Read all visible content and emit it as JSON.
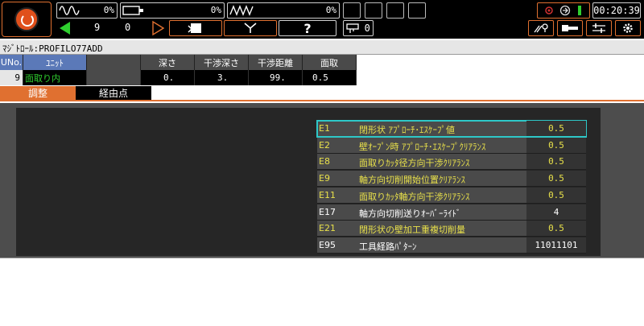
{
  "topbar": {
    "spindle_load_pct": "0%",
    "feed_load_pct": "0%",
    "axis_load_pct": "0%",
    "counter_left": "9",
    "counter_right": "0",
    "key_count": "0",
    "clock": "00:20:39",
    "help_label": "?"
  },
  "titlebar": {
    "program": "ﾏｼﾞﾄﾛｰﾙ:PROFILO77ADD"
  },
  "unit_table": {
    "headers": {
      "uno": "UNo.",
      "unit": "ﾕﾆｯﾄ",
      "depth": "深さ",
      "interference_depth": "干渉深さ",
      "interference_dist": "干渉距離",
      "chamfer": "面取"
    },
    "row": {
      "uno": "9",
      "unit": "面取り内",
      "depth": "0.",
      "interference_depth": "3.",
      "interference_dist": "99.",
      "chamfer": "0.5"
    }
  },
  "tabs": {
    "adjust": "調整",
    "waypoint": "経由点"
  },
  "params": [
    {
      "code": "E1",
      "name": "閉形状 ｱﾌﾟﾛｰﾁ･ｴｽｹｰﾌﾟ値",
      "value": "0.5",
      "color": "#e8e04a"
    },
    {
      "code": "E2",
      "name": "壁ｵｰﾌﾟﾝ時 ｱﾌﾟﾛｰﾁ･ｴｽｹｰﾌﾟｸﾘｱﾗﾝｽ",
      "value": "0.5",
      "color": "#e8e04a"
    },
    {
      "code": "E8",
      "name": "面取りｶｯﾀ径方向干渉ｸﾘｱﾗﾝｽ",
      "value": "0.5",
      "color": "#e8e04a"
    },
    {
      "code": "E9",
      "name": "軸方向切削開始位置ｸﾘｱﾗﾝｽ",
      "value": "0.5",
      "color": "#e8e04a"
    },
    {
      "code": "E11",
      "name": "面取りｶｯﾀ軸方向干渉ｸﾘｱﾗﾝｽ",
      "value": "0.5",
      "color": "#e8e04a"
    },
    {
      "code": "E17",
      "name": "軸方向切削送りｵｰﾊﾞｰﾗｲﾄﾞ",
      "value": "4",
      "color": "#ffffff"
    },
    {
      "code": "E21",
      "name": "閉形状の壁加工重複切削量",
      "value": "0.5",
      "color": "#e8e04a"
    },
    {
      "code": "E95",
      "name": "工具経路ﾊﾟﾀｰﾝ",
      "value": "11011101",
      "color": "#ffffff"
    }
  ],
  "colors": {
    "accent": "#e07030",
    "param_yellow": "#e8e04a",
    "selection": "#2ec8c8"
  }
}
